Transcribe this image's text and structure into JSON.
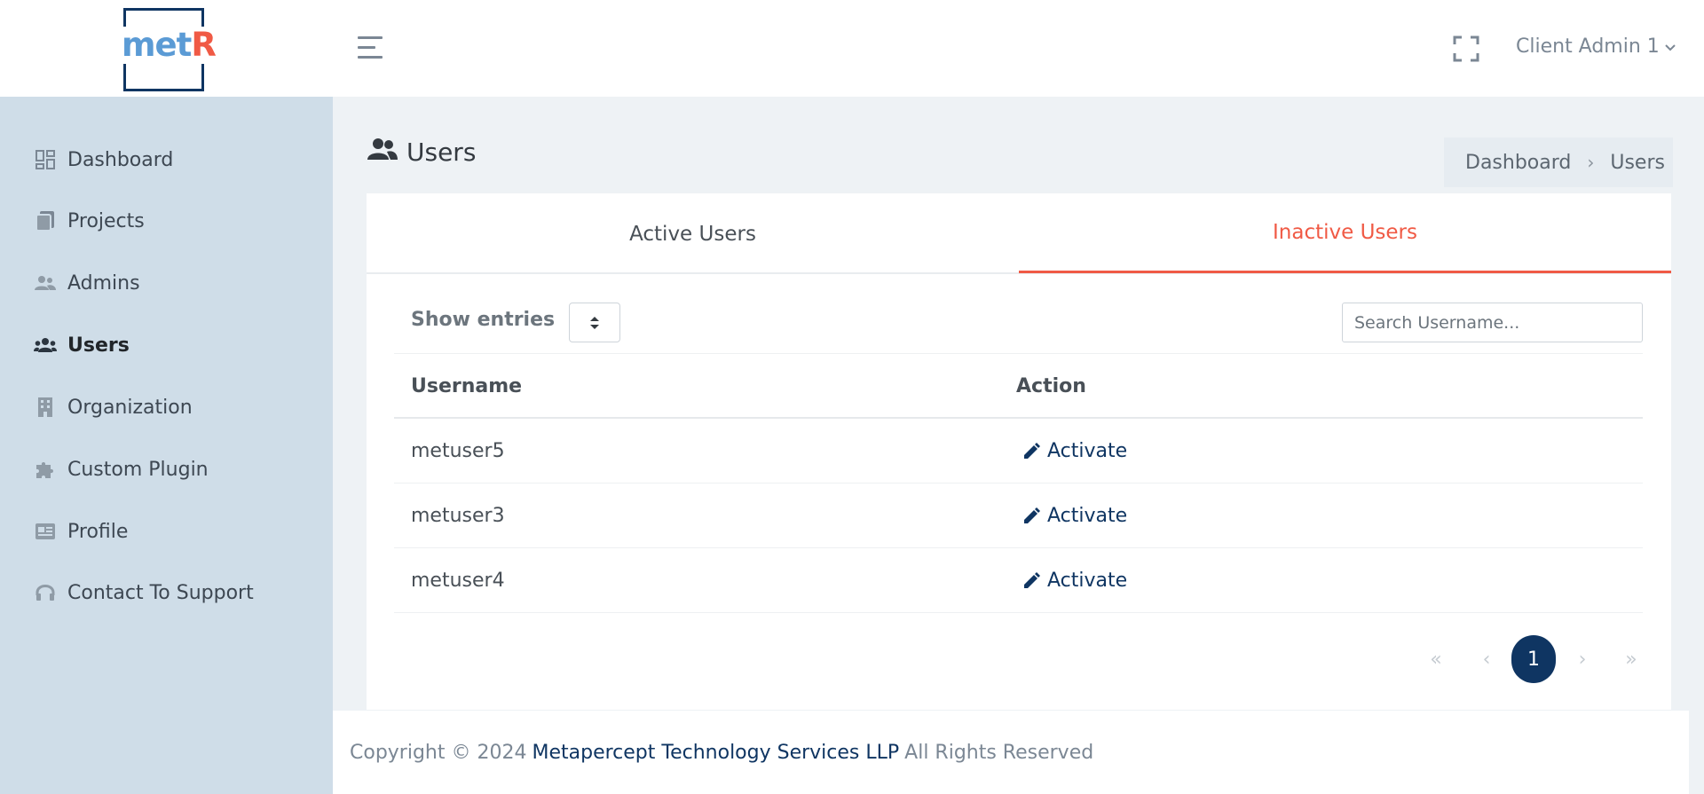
{
  "header": {
    "logo": {
      "part1": "met",
      "part2": "R"
    },
    "user_name": "Client Admin 1"
  },
  "sidebar": {
    "items": [
      {
        "label": "Dashboard",
        "icon": "dashboard-icon"
      },
      {
        "label": "Projects",
        "icon": "clipboard-icon"
      },
      {
        "label": "Admins",
        "icon": "admins-icon"
      },
      {
        "label": "Users",
        "icon": "users-icon",
        "active": true
      },
      {
        "label": "Organization",
        "icon": "building-icon"
      },
      {
        "label": "Custom Plugin",
        "icon": "puzzle-icon"
      },
      {
        "label": "Profile",
        "icon": "id-card-icon"
      },
      {
        "label": "Contact To Support",
        "icon": "headset-icon"
      }
    ]
  },
  "page": {
    "title": "Users",
    "breadcrumb": [
      "Dashboard",
      "Users"
    ]
  },
  "tabs": [
    {
      "label": "Active Users",
      "active": false
    },
    {
      "label": "Inactive Users",
      "active": true
    }
  ],
  "toolbar": {
    "show_entries_label": "Show entries",
    "search_placeholder": "Search Username..."
  },
  "table": {
    "columns": [
      "Username",
      "Action"
    ],
    "rows": [
      {
        "username": "metuser5",
        "action": "Activate"
      },
      {
        "username": "metuser3",
        "action": "Activate"
      },
      {
        "username": "metuser4",
        "action": "Activate"
      }
    ]
  },
  "pagination": {
    "first": "«",
    "prev": "‹",
    "current": "1",
    "next": "›",
    "last": "»"
  },
  "footer": {
    "prefix": "Copyright © 2024",
    "company": "Metapercept Technology Services LLP",
    "suffix": "All Rights Reserved"
  },
  "colors": {
    "accent": "#f05a45",
    "primary": "#0f3562",
    "sidebar_bg": "#cfdde8"
  }
}
